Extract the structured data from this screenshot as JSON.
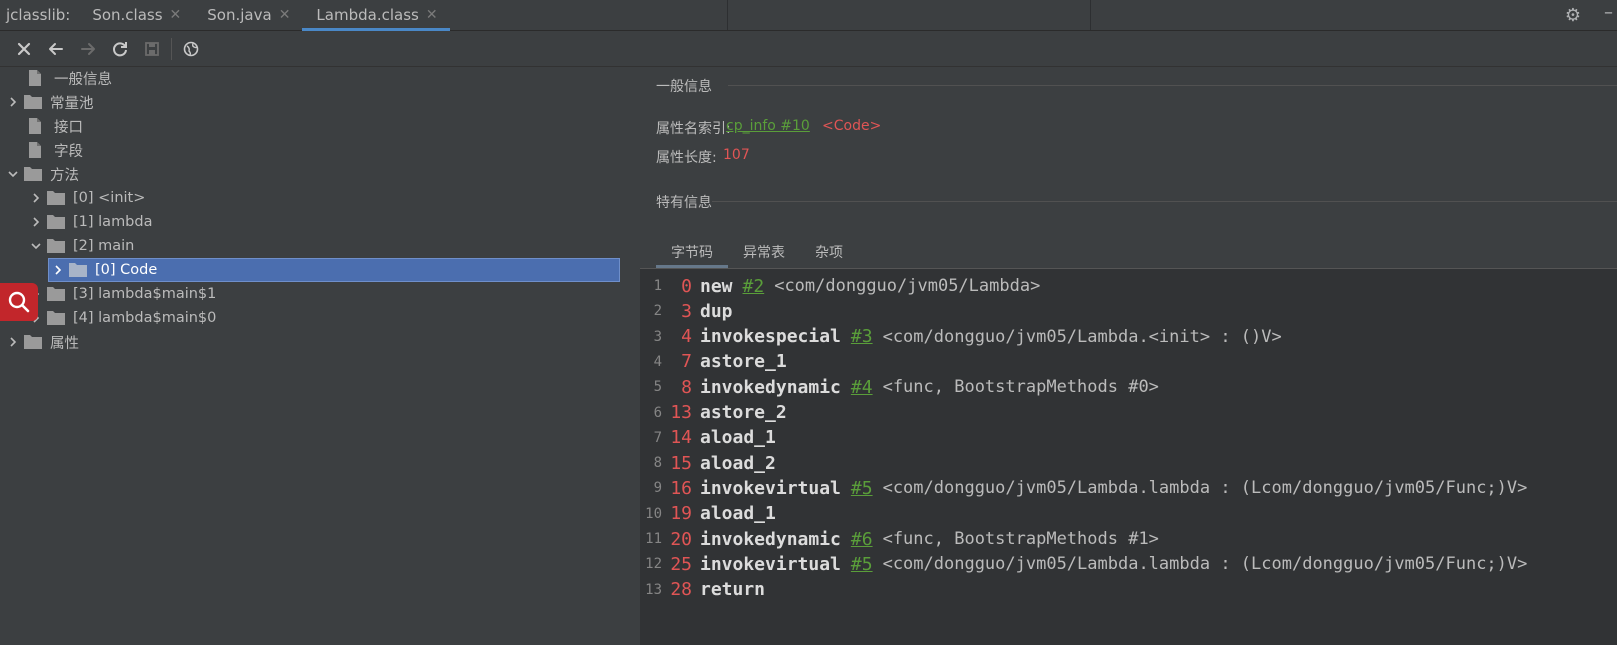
{
  "tabbar": {
    "plugin_name": "jclasslib:",
    "tabs": [
      {
        "label": "Son.class",
        "active": false
      },
      {
        "label": "Son.java",
        "active": false
      },
      {
        "label": "Lambda.class",
        "active": true
      }
    ]
  },
  "toolbar": {
    "buttons": [
      "close-icon",
      "back-arrow-icon",
      "forward-arrow-icon",
      "refresh-icon",
      "save-icon",
      "web-icon"
    ]
  },
  "tree": {
    "items": [
      {
        "label": "一般信息",
        "type": "file"
      },
      {
        "label": "常量池",
        "type": "folder",
        "expandable": true
      },
      {
        "label": "接口",
        "type": "file"
      },
      {
        "label": "字段",
        "type": "file"
      },
      {
        "label": "方法",
        "type": "folder",
        "expanded": true
      },
      {
        "label": "[0] <init>",
        "type": "folder",
        "expandable": true
      },
      {
        "label": "[1] lambda",
        "type": "folder",
        "expandable": true
      },
      {
        "label": "[2] main",
        "type": "folder",
        "expanded": true
      },
      {
        "label": "[0] Code",
        "type": "folder",
        "expandable": true,
        "selected": true
      },
      {
        "label": "[3] lambda$main$1",
        "type": "folder",
        "expandable": true
      },
      {
        "label": "[4] lambda$main$0",
        "type": "folder",
        "expandable": true
      },
      {
        "label": "属性",
        "type": "folder",
        "expandable": true
      }
    ]
  },
  "detail": {
    "general_title": "一般信息",
    "name_index_label": "属性名索引:",
    "name_index_link": "cp_info #10",
    "name_index_value": "<Code>",
    "length_label": "属性长度:",
    "length_value": "107",
    "specific_title": "特有信息",
    "subtabs": [
      {
        "label": "字节码",
        "active": true
      },
      {
        "label": "异常表",
        "active": false
      },
      {
        "label": "杂项",
        "active": false
      }
    ]
  },
  "bytecode": [
    {
      "line": "1",
      "offset": "0",
      "op": "new",
      "ref": "#2",
      "comment": "<com/dongguo/jvm05/Lambda>"
    },
    {
      "line": "2",
      "offset": "3",
      "op": "dup",
      "ref": "",
      "comment": ""
    },
    {
      "line": "3",
      "offset": "4",
      "op": "invokespecial",
      "ref": "#3",
      "comment": "<com/dongguo/jvm05/Lambda.<init> : ()V>"
    },
    {
      "line": "4",
      "offset": "7",
      "op": "astore_1",
      "ref": "",
      "comment": ""
    },
    {
      "line": "5",
      "offset": "8",
      "op": "invokedynamic",
      "ref": "#4",
      "comment": "<func, BootstrapMethods #0>"
    },
    {
      "line": "6",
      "offset": "13",
      "op": "astore_2",
      "ref": "",
      "comment": ""
    },
    {
      "line": "7",
      "offset": "14",
      "op": "aload_1",
      "ref": "",
      "comment": ""
    },
    {
      "line": "8",
      "offset": "15",
      "op": "aload_2",
      "ref": "",
      "comment": ""
    },
    {
      "line": "9",
      "offset": "16",
      "op": "invokevirtual",
      "ref": "#5",
      "comment": "<com/dongguo/jvm05/Lambda.lambda : (Lcom/dongguo/jvm05/Func;)V>"
    },
    {
      "line": "10",
      "offset": "19",
      "op": "aload_1",
      "ref": "",
      "comment": ""
    },
    {
      "line": "11",
      "offset": "20",
      "op": "invokedynamic",
      "ref": "#6",
      "comment": "<func, BootstrapMethods #1>"
    },
    {
      "line": "12",
      "offset": "25",
      "op": "invokevirtual",
      "ref": "#5",
      "comment": "<com/dongguo/jvm05/Lambda.lambda : (Lcom/dongguo/jvm05/Func;)V>"
    },
    {
      "line": "13",
      "offset": "28",
      "op": "return",
      "ref": "",
      "comment": ""
    }
  ],
  "colors": {
    "selection": "#4b6eaf",
    "link": "#5a9e3a",
    "value": "#e05555",
    "accent": "#4a88c7"
  }
}
